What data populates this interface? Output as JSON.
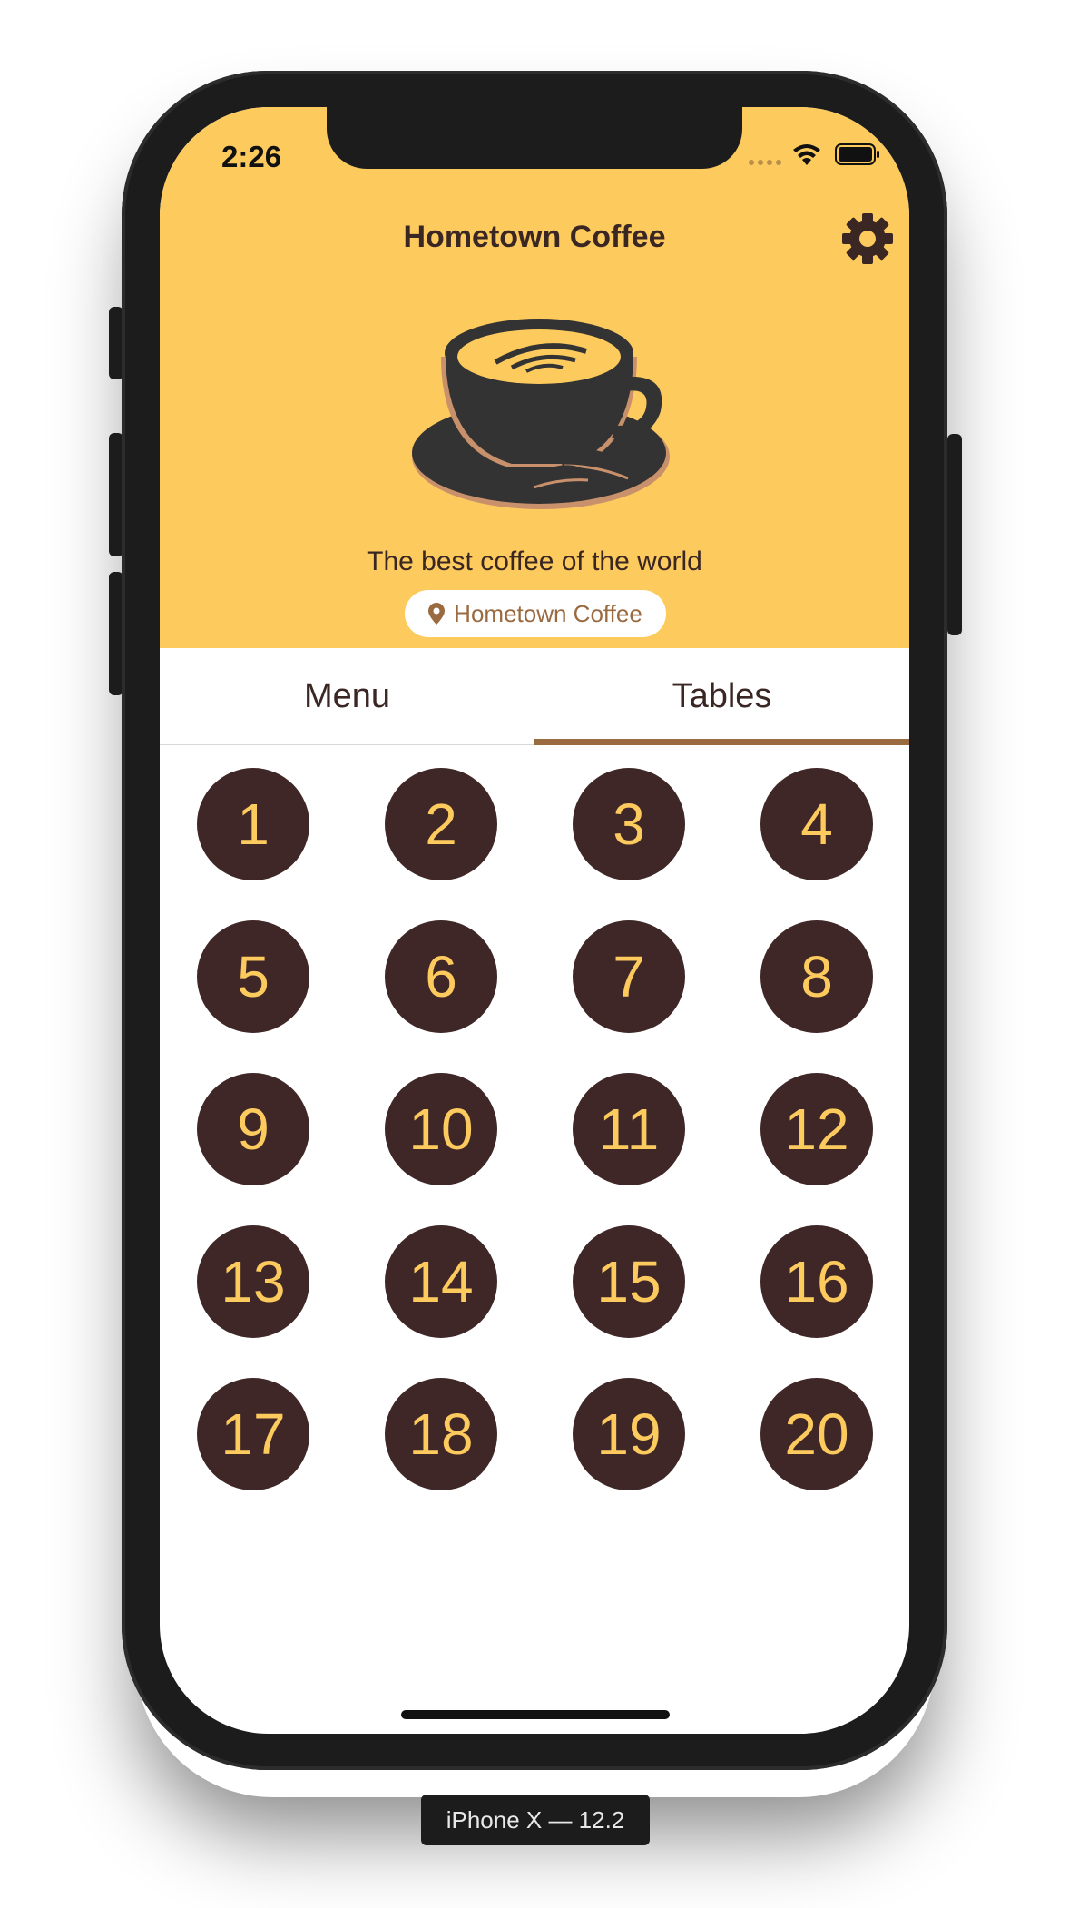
{
  "status_bar": {
    "time": "2:26"
  },
  "header": {
    "title": "Hometown Coffee",
    "tagline": "The best coffee of the world",
    "location": "Hometown Coffee",
    "settings_icon": "gear-icon",
    "background_color": "#fcca5d"
  },
  "tabs": [
    {
      "label": "Menu",
      "selected": false
    },
    {
      "label": "Tables",
      "selected": true
    }
  ],
  "tables": [
    "1",
    "2",
    "3",
    "4",
    "5",
    "6",
    "7",
    "8",
    "9",
    "10",
    "11",
    "12",
    "13",
    "14",
    "15",
    "16",
    "17",
    "18",
    "19",
    "20"
  ],
  "colors": {
    "table_fill": "#3f2727",
    "table_text": "#fcca5d",
    "tab_indicator": "#9a6a40",
    "primary_text": "#3a2622"
  },
  "device_label": "iPhone X — 12.2"
}
